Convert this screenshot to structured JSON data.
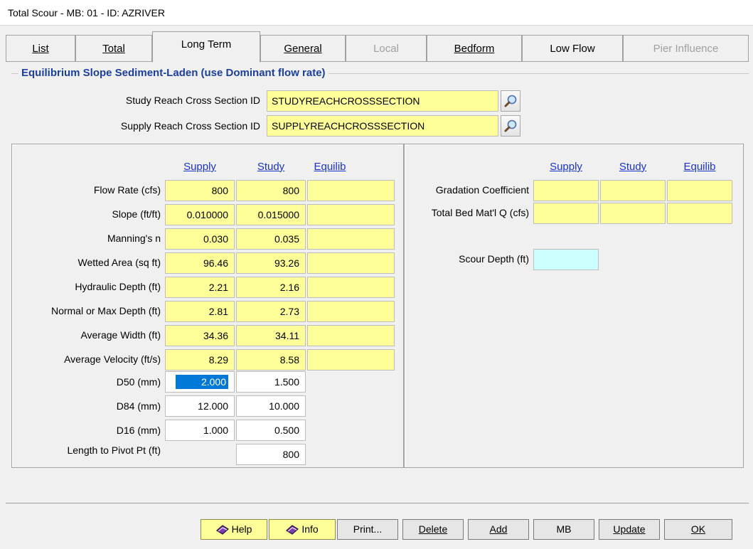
{
  "window": {
    "title": "Total Scour - MB: 01 - ID: AZRIVER"
  },
  "tabs": [
    {
      "label": "List"
    },
    {
      "label": "Total"
    },
    {
      "label": "Long Term"
    },
    {
      "label": "General"
    },
    {
      "label": "Local"
    },
    {
      "label": "Bedform"
    },
    {
      "label": "Low Flow"
    },
    {
      "label": "Pier Influence"
    }
  ],
  "section": {
    "title": "Equilibrium Slope Sediment-Laden (use Dominant flow rate)",
    "study_reach_label": "Study Reach Cross Section ID",
    "study_reach_value": "STUDYREACHCROSSSECTION",
    "supply_reach_label": "Supply Reach Cross Section ID",
    "supply_reach_value": "SUPPLYREACHCROSSSECTION"
  },
  "left_table": {
    "headers": [
      "Supply",
      "Study",
      "Equilib"
    ],
    "rows": [
      {
        "label": "Flow Rate (cfs)",
        "supply": "800",
        "study": "800",
        "equilib": ""
      },
      {
        "label": "Slope (ft/ft)",
        "supply": "0.010000",
        "study": "0.015000",
        "equilib": ""
      },
      {
        "label": "Manning's n",
        "supply": "0.030",
        "study": "0.035",
        "equilib": ""
      },
      {
        "label": "Wetted Area (sq ft)",
        "supply": "96.46",
        "study": "93.26",
        "equilib": ""
      },
      {
        "label": "Hydraulic Depth (ft)",
        "supply": "2.21",
        "study": "2.16",
        "equilib": ""
      },
      {
        "label": "Normal or Max Depth (ft)",
        "supply": "2.81",
        "study": "2.73",
        "equilib": ""
      },
      {
        "label": "Average Width (ft)",
        "supply": "34.36",
        "study": "34.11",
        "equilib": ""
      },
      {
        "label": "Average Velocity (ft/s)",
        "supply": "8.29",
        "study": "8.58",
        "equilib": ""
      },
      {
        "label": "D50 (mm)",
        "supply": "2.000",
        "study": "1.500"
      },
      {
        "label": "D84 (mm)",
        "supply": "12.000",
        "study": "10.000"
      },
      {
        "label": "D16 (mm)",
        "supply": "1.000",
        "study": "0.500"
      },
      {
        "label": "Length to Pivot Pt (ft)",
        "study": "800"
      }
    ]
  },
  "right_table": {
    "headers": [
      "Supply",
      "Study",
      "Equilib"
    ],
    "rows": [
      {
        "label": "Gradation Coefficient",
        "supply": "",
        "study": "",
        "equilib": ""
      },
      {
        "label": "Total Bed Mat'l Q (cfs)",
        "supply": "",
        "study": "",
        "equilib": ""
      }
    ],
    "scour_label": "Scour Depth (ft)",
    "scour_value": ""
  },
  "buttons": [
    {
      "label": "Help"
    },
    {
      "label": "Info"
    },
    {
      "label": "Print..."
    },
    {
      "label": "Delete"
    },
    {
      "label": "Add"
    },
    {
      "label": "MB"
    },
    {
      "label": "Update"
    },
    {
      "label": "OK"
    }
  ],
  "colors": {
    "input_yellow": "#ffff99",
    "result_cyan": "#ccffff",
    "header_blue": "#1a33c7",
    "section_title": "#1c3f9e",
    "selection": "#0078d7"
  }
}
